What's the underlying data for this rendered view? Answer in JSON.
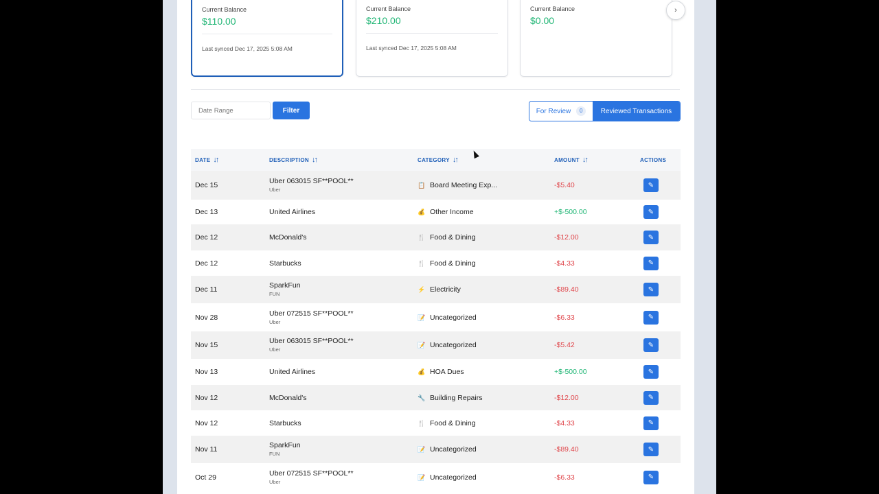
{
  "cards": [
    {
      "label": "Current Balance",
      "value": "$110.00",
      "sync": "Last synced Dec 17, 2025 5:08 AM"
    },
    {
      "label": "Current Balance",
      "value": "$210.00",
      "sync": "Last synced Dec 17, 2025 5:08 AM"
    },
    {
      "label": "Current Balance",
      "value": "$0.00",
      "sync": ""
    }
  ],
  "next_icon": "›",
  "filter": {
    "placeholder": "Date Range",
    "button": "Filter"
  },
  "toggle": {
    "for_review": "For Review",
    "count": "0",
    "reviewed": "Reviewed Transactions"
  },
  "columns": {
    "date": "DATE",
    "description": "DESCRIPTION",
    "category": "CATEGORY",
    "amount": "AMOUNT",
    "actions": "ACTIONS"
  },
  "sort_icon": "↓↑",
  "edit_icon": "✎",
  "rows": [
    {
      "date": "Dec 15",
      "desc": "Uber 063015 SF**POOL**",
      "sub": "Uber",
      "icon": "📋",
      "category": "Board Meeting Exp...",
      "amount": "-$5.40",
      "positive": false
    },
    {
      "date": "Dec 13",
      "desc": "United Airlines",
      "sub": "",
      "icon": "💰",
      "category": "Other Income",
      "amount": "+$-500.00",
      "positive": true
    },
    {
      "date": "Dec 12",
      "desc": "McDonald's",
      "sub": "",
      "icon": "🍴",
      "category": "Food & Dining",
      "amount": "-$12.00",
      "positive": false
    },
    {
      "date": "Dec 12",
      "desc": "Starbucks",
      "sub": "",
      "icon": "🍴",
      "category": "Food & Dining",
      "amount": "-$4.33",
      "positive": false
    },
    {
      "date": "Dec 11",
      "desc": "SparkFun",
      "sub": "FUN",
      "icon": "⚡",
      "category": "Electricity",
      "amount": "-$89.40",
      "positive": false
    },
    {
      "date": "Nov 28",
      "desc": "Uber 072515 SF**POOL**",
      "sub": "Uber",
      "icon": "📝",
      "category": "Uncategorized",
      "amount": "-$6.33",
      "positive": false
    },
    {
      "date": "Nov 15",
      "desc": "Uber 063015 SF**POOL**",
      "sub": "Uber",
      "icon": "📝",
      "category": "Uncategorized",
      "amount": "-$5.42",
      "positive": false
    },
    {
      "date": "Nov 13",
      "desc": "United Airlines",
      "sub": "",
      "icon": "💰",
      "category": "HOA Dues",
      "amount": "+$-500.00",
      "positive": true
    },
    {
      "date": "Nov 12",
      "desc": "McDonald's",
      "sub": "",
      "icon": "🔧",
      "category": "Building Repairs",
      "amount": "-$12.00",
      "positive": false
    },
    {
      "date": "Nov 12",
      "desc": "Starbucks",
      "sub": "",
      "icon": "🍴",
      "category": "Food & Dining",
      "amount": "-$4.33",
      "positive": false
    },
    {
      "date": "Nov 11",
      "desc": "SparkFun",
      "sub": "FUN",
      "icon": "📝",
      "category": "Uncategorized",
      "amount": "-$89.40",
      "positive": false
    },
    {
      "date": "Oct 29",
      "desc": "Uber 072515 SF**POOL**",
      "sub": "Uber",
      "icon": "📝",
      "category": "Uncategorized",
      "amount": "-$6.33",
      "positive": false
    }
  ]
}
